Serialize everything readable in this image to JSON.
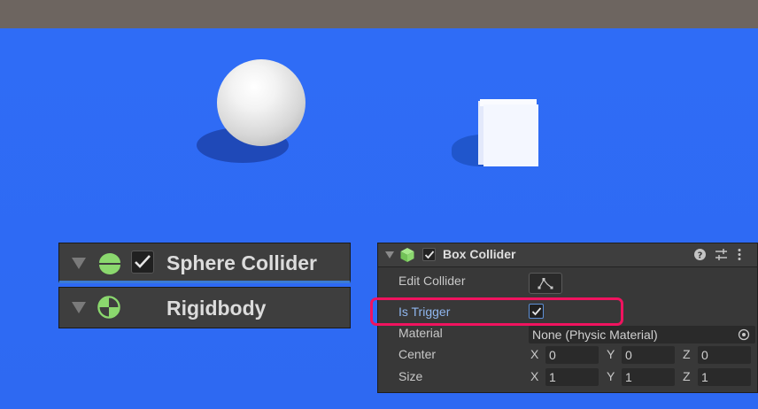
{
  "left_panel": {
    "sphere_collider": {
      "title": "Sphere Collider",
      "enabled": true
    },
    "rigidbody": {
      "title": "Rigidbody"
    }
  },
  "box_collider": {
    "title": "Box Collider",
    "enabled": true,
    "edit_collider_label": "Edit Collider",
    "is_trigger_label": "Is Trigger",
    "is_trigger": true,
    "material_label": "Material",
    "material_value": "None (Physic Material)",
    "center_label": "Center",
    "size_label": "Size",
    "center": {
      "x_label": "X",
      "y_label": "Y",
      "z_label": "Z",
      "x": "0",
      "y": "0",
      "z": "0"
    },
    "size": {
      "x_label": "X",
      "y_label": "Y",
      "z_label": "Z",
      "x": "1",
      "y": "1",
      "z": "1"
    }
  },
  "colors": {
    "scene_background": "#2f6cf5",
    "highlight_border": "#f0135f",
    "component_icon": "#8bd86e"
  },
  "icons": [
    "sphere-collider-icon",
    "rigidbody-icon",
    "box-collider-icon",
    "help-icon",
    "presets-icon",
    "more-icon",
    "edit-collider-icon",
    "object-picker-icon"
  ]
}
